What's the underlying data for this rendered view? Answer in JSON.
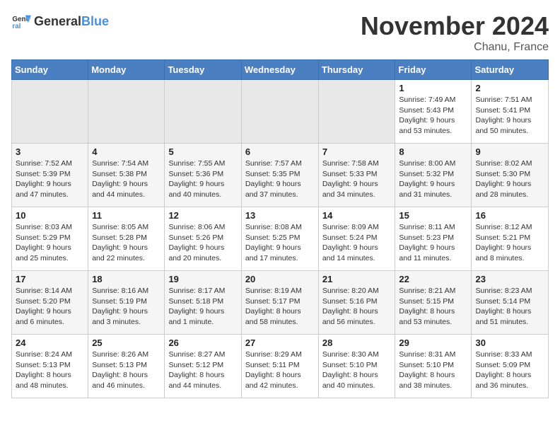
{
  "header": {
    "logo_general": "General",
    "logo_blue": "Blue",
    "month_title": "November 2024",
    "location": "Chanu, France"
  },
  "weekdays": [
    "Sunday",
    "Monday",
    "Tuesday",
    "Wednesday",
    "Thursday",
    "Friday",
    "Saturday"
  ],
  "weeks": [
    [
      {
        "day": "",
        "info": ""
      },
      {
        "day": "",
        "info": ""
      },
      {
        "day": "",
        "info": ""
      },
      {
        "day": "",
        "info": ""
      },
      {
        "day": "",
        "info": ""
      },
      {
        "day": "1",
        "info": "Sunrise: 7:49 AM\nSunset: 5:43 PM\nDaylight: 9 hours and 53 minutes."
      },
      {
        "day": "2",
        "info": "Sunrise: 7:51 AM\nSunset: 5:41 PM\nDaylight: 9 hours and 50 minutes."
      }
    ],
    [
      {
        "day": "3",
        "info": "Sunrise: 7:52 AM\nSunset: 5:39 PM\nDaylight: 9 hours and 47 minutes."
      },
      {
        "day": "4",
        "info": "Sunrise: 7:54 AM\nSunset: 5:38 PM\nDaylight: 9 hours and 44 minutes."
      },
      {
        "day": "5",
        "info": "Sunrise: 7:55 AM\nSunset: 5:36 PM\nDaylight: 9 hours and 40 minutes."
      },
      {
        "day": "6",
        "info": "Sunrise: 7:57 AM\nSunset: 5:35 PM\nDaylight: 9 hours and 37 minutes."
      },
      {
        "day": "7",
        "info": "Sunrise: 7:58 AM\nSunset: 5:33 PM\nDaylight: 9 hours and 34 minutes."
      },
      {
        "day": "8",
        "info": "Sunrise: 8:00 AM\nSunset: 5:32 PM\nDaylight: 9 hours and 31 minutes."
      },
      {
        "day": "9",
        "info": "Sunrise: 8:02 AM\nSunset: 5:30 PM\nDaylight: 9 hours and 28 minutes."
      }
    ],
    [
      {
        "day": "10",
        "info": "Sunrise: 8:03 AM\nSunset: 5:29 PM\nDaylight: 9 hours and 25 minutes."
      },
      {
        "day": "11",
        "info": "Sunrise: 8:05 AM\nSunset: 5:28 PM\nDaylight: 9 hours and 22 minutes."
      },
      {
        "day": "12",
        "info": "Sunrise: 8:06 AM\nSunset: 5:26 PM\nDaylight: 9 hours and 20 minutes."
      },
      {
        "day": "13",
        "info": "Sunrise: 8:08 AM\nSunset: 5:25 PM\nDaylight: 9 hours and 17 minutes."
      },
      {
        "day": "14",
        "info": "Sunrise: 8:09 AM\nSunset: 5:24 PM\nDaylight: 9 hours and 14 minutes."
      },
      {
        "day": "15",
        "info": "Sunrise: 8:11 AM\nSunset: 5:23 PM\nDaylight: 9 hours and 11 minutes."
      },
      {
        "day": "16",
        "info": "Sunrise: 8:12 AM\nSunset: 5:21 PM\nDaylight: 9 hours and 8 minutes."
      }
    ],
    [
      {
        "day": "17",
        "info": "Sunrise: 8:14 AM\nSunset: 5:20 PM\nDaylight: 9 hours and 6 minutes."
      },
      {
        "day": "18",
        "info": "Sunrise: 8:16 AM\nSunset: 5:19 PM\nDaylight: 9 hours and 3 minutes."
      },
      {
        "day": "19",
        "info": "Sunrise: 8:17 AM\nSunset: 5:18 PM\nDaylight: 9 hours and 1 minute."
      },
      {
        "day": "20",
        "info": "Sunrise: 8:19 AM\nSunset: 5:17 PM\nDaylight: 8 hours and 58 minutes."
      },
      {
        "day": "21",
        "info": "Sunrise: 8:20 AM\nSunset: 5:16 PM\nDaylight: 8 hours and 56 minutes."
      },
      {
        "day": "22",
        "info": "Sunrise: 8:21 AM\nSunset: 5:15 PM\nDaylight: 8 hours and 53 minutes."
      },
      {
        "day": "23",
        "info": "Sunrise: 8:23 AM\nSunset: 5:14 PM\nDaylight: 8 hours and 51 minutes."
      }
    ],
    [
      {
        "day": "24",
        "info": "Sunrise: 8:24 AM\nSunset: 5:13 PM\nDaylight: 8 hours and 48 minutes."
      },
      {
        "day": "25",
        "info": "Sunrise: 8:26 AM\nSunset: 5:13 PM\nDaylight: 8 hours and 46 minutes."
      },
      {
        "day": "26",
        "info": "Sunrise: 8:27 AM\nSunset: 5:12 PM\nDaylight: 8 hours and 44 minutes."
      },
      {
        "day": "27",
        "info": "Sunrise: 8:29 AM\nSunset: 5:11 PM\nDaylight: 8 hours and 42 minutes."
      },
      {
        "day": "28",
        "info": "Sunrise: 8:30 AM\nSunset: 5:10 PM\nDaylight: 8 hours and 40 minutes."
      },
      {
        "day": "29",
        "info": "Sunrise: 8:31 AM\nSunset: 5:10 PM\nDaylight: 8 hours and 38 minutes."
      },
      {
        "day": "30",
        "info": "Sunrise: 8:33 AM\nSunset: 5:09 PM\nDaylight: 8 hours and 36 minutes."
      }
    ]
  ]
}
